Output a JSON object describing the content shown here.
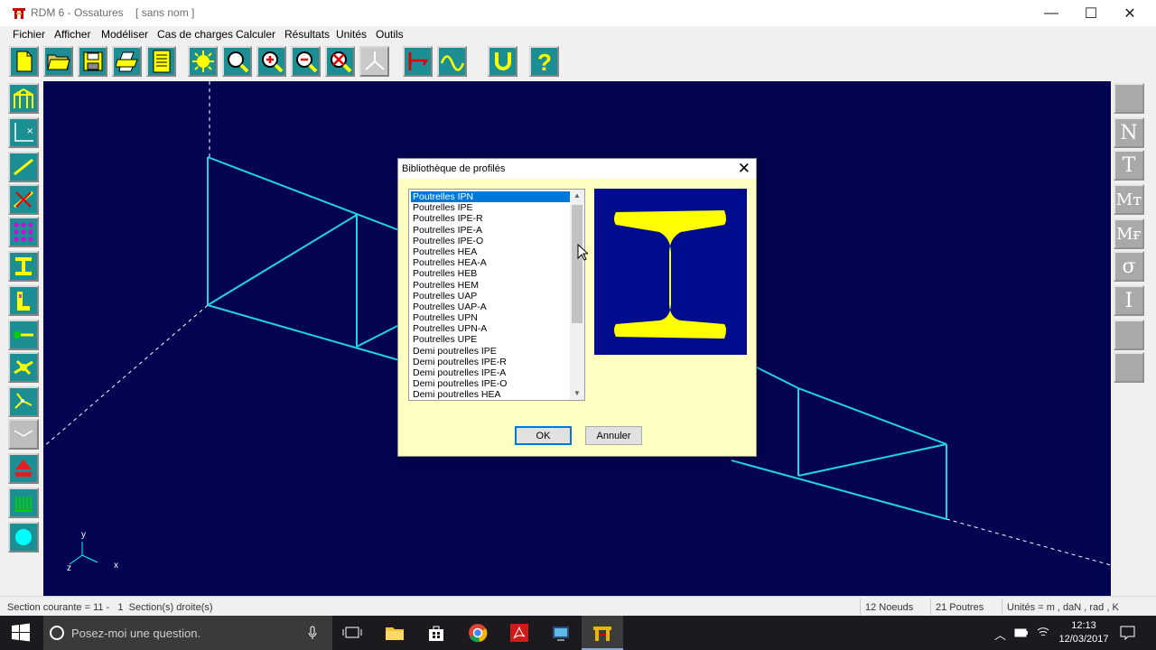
{
  "window": {
    "title": "RDM 6 - Ossatures    [ sans nom ]",
    "minimize_glyph": "—",
    "maximize_glyph": "☐",
    "close_glyph": "✕"
  },
  "menu": [
    "Fichier",
    "Afficher",
    "Modéliser",
    "Cas de charges",
    "Calculer",
    "Résultats",
    "Unités",
    "Outils"
  ],
  "toolbar_icons": [
    "new-file-icon",
    "open-folder-icon",
    "save-icon",
    "print-icon",
    "notes-icon",
    "sun-icon",
    "zoom-icon",
    "zoom-in-icon",
    "zoom-out-icon",
    "zoom-cancel-icon",
    "axes-3d-icon",
    "flag-icon",
    "wave-icon",
    "magnet-icon",
    "help-icon"
  ],
  "right_palette": [
    "",
    "N",
    "T",
    "Mт",
    "Mғ",
    "σ",
    "Ι",
    "",
    ""
  ],
  "canvas_axes": {
    "y": "y",
    "z": "z",
    "x": "x"
  },
  "dialog": {
    "title": "Bibliothèque de profilés",
    "close_glyph": "✕",
    "items": [
      "Poutrelles IPN",
      "Poutrelles IPE",
      "Poutrelles IPE-R",
      "Poutrelles IPE-A",
      "Poutrelles IPE-O",
      "Poutrelles HEA",
      "Poutrelles HEA-A",
      "Poutrelles HEB",
      "Poutrelles HEM",
      "Poutrelles UAP",
      "Poutrelles UAP-A",
      "Poutrelles UPN",
      "Poutrelles UPN-A",
      "Poutrelles UPE",
      "Demi poutrelles IPE",
      "Demi poutrelles IPE-R",
      "Demi poutrelles IPE-A",
      "Demi poutrelles IPE-O",
      "Demi poutrelles HEA"
    ],
    "selected_index": 0,
    "ok_label": "OK",
    "cancel_label": "Annuler",
    "preview_color": "#ffff00",
    "preview_bg": "#000c8e"
  },
  "status": {
    "section": "Section courante = 11 -   1  Section(s) droite(s)",
    "nodes": "12 Noeuds",
    "beams": "21 Poutres",
    "units": "Unités = m , daN , rad , K"
  },
  "taskbar": {
    "search_placeholder": "Posez-moi une question.",
    "time": "12:13",
    "date": "12/03/2017"
  },
  "colors": {
    "canvas": "#020452",
    "structure": "#22d3e6",
    "dialog_bg": "#ffffc4"
  }
}
